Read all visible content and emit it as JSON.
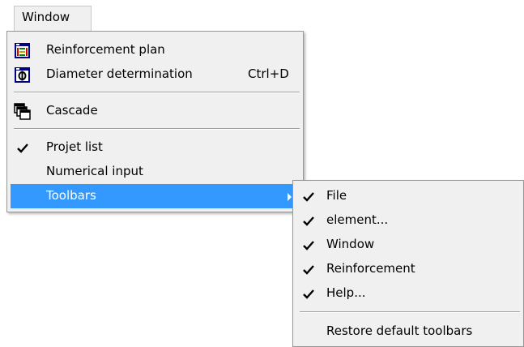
{
  "menubar": {
    "window_label": "Window"
  },
  "window_menu": {
    "items": [
      {
        "label": "Reinforcement plan",
        "shortcut": "",
        "icon": "reinforcement-plan-icon"
      },
      {
        "label": "Diameter determination",
        "shortcut": "Ctrl+D",
        "icon": "diameter-icon"
      },
      {
        "label": "Cascade",
        "shortcut": "",
        "icon": "cascade-icon"
      },
      {
        "label": "Projet list",
        "checked": true
      },
      {
        "label": "Numerical input",
        "checked": false
      },
      {
        "label": "Toolbars",
        "submenu": true,
        "highlighted": true
      }
    ]
  },
  "toolbars_menu": {
    "items": [
      {
        "label": "File",
        "checked": true
      },
      {
        "label": "element...",
        "checked": true
      },
      {
        "label": "Window",
        "checked": true
      },
      {
        "label": "Reinforcement",
        "checked": true
      },
      {
        "label": "Help...",
        "checked": true
      },
      {
        "label": "Restore default toolbars",
        "checked": false
      }
    ]
  },
  "colors": {
    "menu_background": "#f0f0f0",
    "highlight": "#3399ff",
    "separator": "#a0a0a0"
  }
}
